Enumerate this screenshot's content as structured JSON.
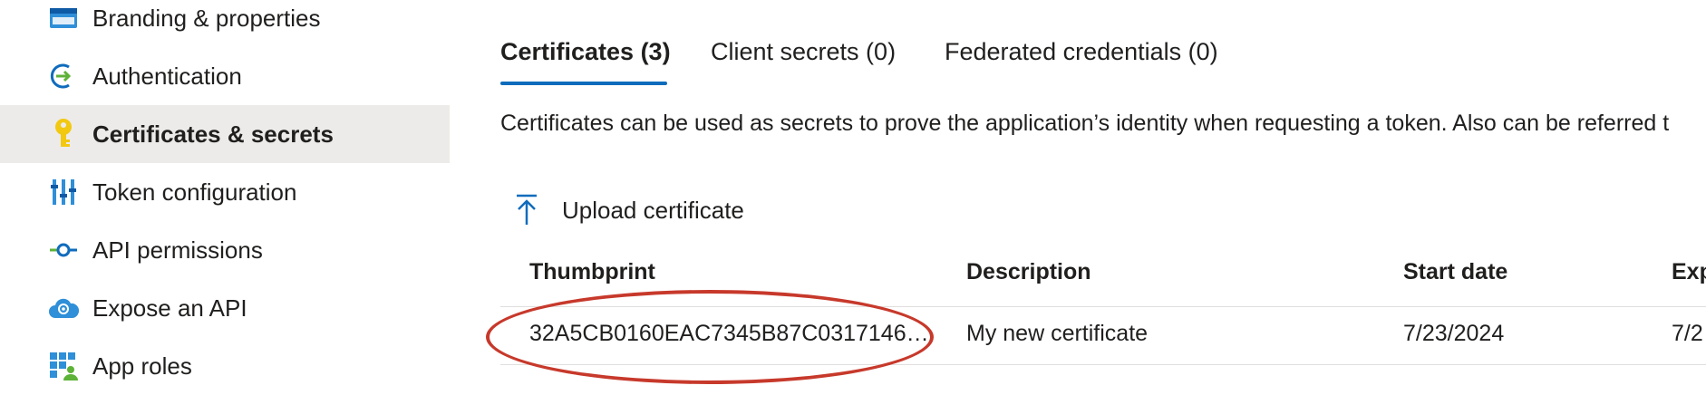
{
  "sidebar": {
    "items": [
      {
        "label": "Branding & properties",
        "icon": "branding-icon",
        "active": false
      },
      {
        "label": "Authentication",
        "icon": "authentication-icon",
        "active": false
      },
      {
        "label": "Certificates & secrets",
        "icon": "key-icon",
        "active": true
      },
      {
        "label": "Token configuration",
        "icon": "token-config-icon",
        "active": false
      },
      {
        "label": "API permissions",
        "icon": "api-permissions-icon",
        "active": false
      },
      {
        "label": "Expose an API",
        "icon": "cloud-icon",
        "active": false
      },
      {
        "label": "App roles",
        "icon": "app-roles-icon",
        "active": false
      }
    ]
  },
  "tabs": [
    {
      "label": "Certificates (3)",
      "active": true
    },
    {
      "label": "Client secrets (0)",
      "active": false
    },
    {
      "label": "Federated credentials (0)",
      "active": false
    }
  ],
  "description": "Certificates can be used as secrets to prove the application’s identity when requesting a token. Also can be referred t",
  "toolbar": {
    "upload_label": "Upload certificate",
    "upload_icon": "upload-arrow-icon"
  },
  "table": {
    "columns": [
      "Thumbprint",
      "Description",
      "Start date",
      "Exp"
    ],
    "rows": [
      {
        "thumbprint": "32A5CB0160EAC7345B87C0317146…",
        "description": "My new certificate",
        "start_date": "7/23/2024",
        "expires": "7/2"
      }
    ]
  },
  "colors": {
    "accent": "#0f6cbd",
    "active_nav_bg": "#edebe9",
    "annotation": "#c7392b",
    "key_icon": "#f2c811"
  }
}
